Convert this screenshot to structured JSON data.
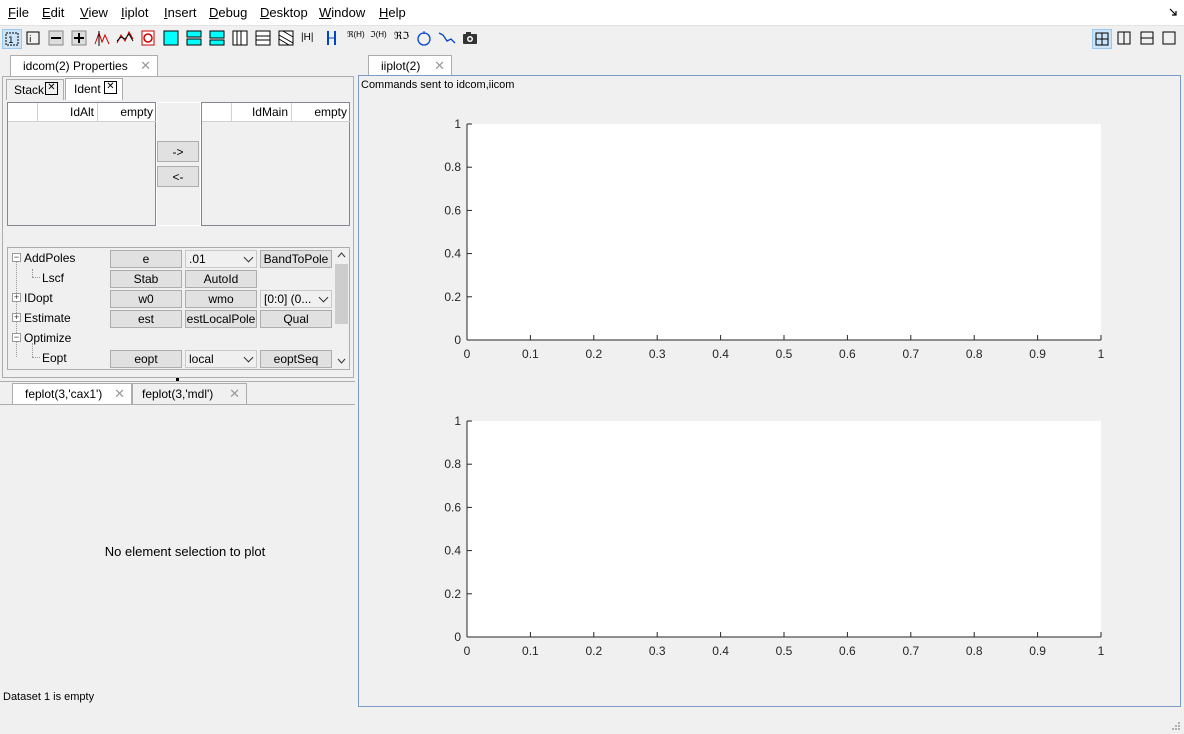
{
  "menubar": {
    "items": [
      {
        "label": "File",
        "u": "F",
        "rest": "ile"
      },
      {
        "label": "Edit",
        "u": "E",
        "rest": "dit"
      },
      {
        "label": "View",
        "u": "V",
        "rest": "iew"
      },
      {
        "label": "Iiplot",
        "u": "I",
        "rest": "iplot"
      },
      {
        "label": "Insert",
        "u": "I",
        "rest": "nsert"
      },
      {
        "label": "Debug",
        "u": "D",
        "rest": "ebug"
      },
      {
        "label": "Desktop",
        "u": "D",
        "rest": "esktop"
      },
      {
        "label": "Window",
        "u": "W",
        "rest": "indow"
      },
      {
        "label": "Help",
        "u": "H",
        "rest": "elp"
      }
    ]
  },
  "toolbar": {
    "text_icons": [
      "|H|",
      "ℜ(H)",
      "ℑ(H)",
      "ℜℑ"
    ]
  },
  "properties_panel": {
    "tab_label": "idcom(2) Properties",
    "subtabs": [
      "Stack",
      "Ident"
    ],
    "left_list": {
      "headers": [
        "",
        "IdAlt",
        "empty"
      ]
    },
    "right_list": {
      "headers": [
        "",
        "IdMain",
        "empty"
      ]
    },
    "move_right_label": "->",
    "move_left_label": "<-",
    "tree": [
      {
        "label": "AddPoles",
        "cells": [
          "e",
          ".01",
          "BandToPole"
        ]
      },
      {
        "label": "Lscf",
        "cells": [
          "Stab",
          "AutoId"
        ]
      },
      {
        "label": "IDopt",
        "cells": [
          "w0",
          "wmo",
          "[0:0] (0..."
        ]
      },
      {
        "label": "Estimate",
        "cells": [
          "est",
          "estLocalPole",
          "Qual"
        ]
      },
      {
        "label": "Optimize",
        "cells": []
      },
      {
        "label": "Eopt",
        "cells": [
          "eopt",
          "local",
          "eoptSeq"
        ]
      }
    ]
  },
  "feplot_panel": {
    "tabs": [
      "feplot(3,'cax1')",
      "feplot(3,'mdl')"
    ],
    "message": "No element selection to plot",
    "status": "Dataset 1 is empty"
  },
  "iiplot_panel": {
    "tab_label": "iiplot(2)",
    "commands_text": "Commands sent to idcom,iicom",
    "axes": [
      {
        "yticks": [
          "0",
          "0.2",
          "0.4",
          "0.6",
          "0.8",
          "1"
        ],
        "xticks": [
          "0",
          "0.1",
          "0.2",
          "0.3",
          "0.4",
          "0.5",
          "0.6",
          "0.7",
          "0.8",
          "0.9",
          "1"
        ]
      },
      {
        "yticks": [
          "0",
          "0.2",
          "0.4",
          "0.6",
          "0.8",
          "1"
        ],
        "xticks": [
          "0",
          "0.1",
          "0.2",
          "0.3",
          "0.4",
          "0.5",
          "0.6",
          "0.7",
          "0.8",
          "0.9",
          "1"
        ]
      }
    ]
  },
  "colors": {
    "accent_cyan": "#00ffff",
    "panel_border": "#7a9cc6"
  }
}
